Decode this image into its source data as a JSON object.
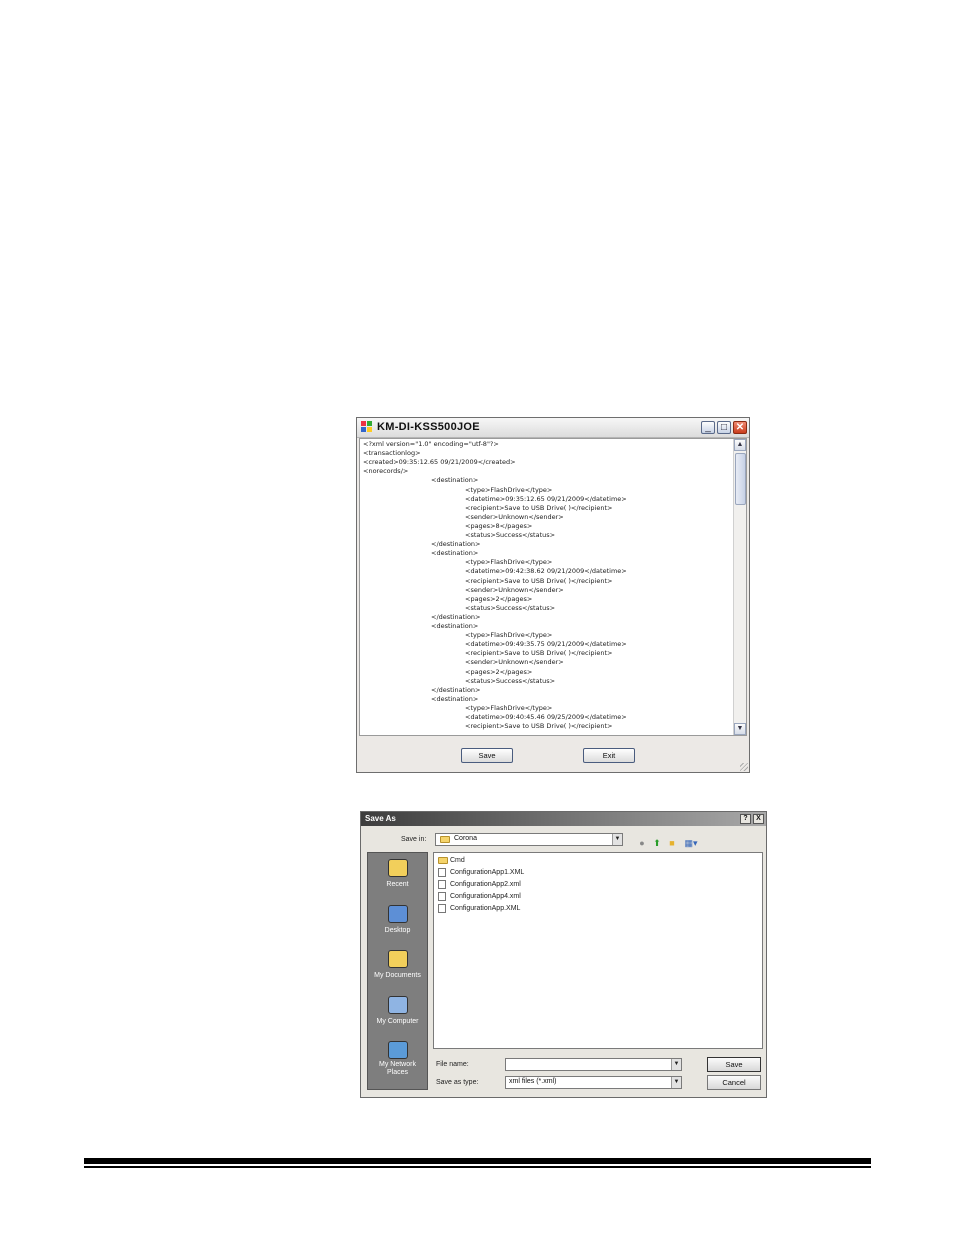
{
  "xml_window": {
    "title": "KM-DI-KSS500JOE",
    "lines": [
      {
        "indent": 0,
        "text": "<?xml version=\"1.0\" encoding=\"utf-8\"?>"
      },
      {
        "indent": 0,
        "text": "<transactionlog>"
      },
      {
        "indent": 0,
        "text": "<created>09:35:12.65 09/21/2009</created>"
      },
      {
        "indent": 0,
        "text": "<norecords/>"
      },
      {
        "indent": 1,
        "text": "<destination>"
      },
      {
        "indent": 2,
        "text": "<type>FlashDrive</type>"
      },
      {
        "indent": 2,
        "text": "<datetime>09:35:12.65 09/21/2009</datetime>"
      },
      {
        "indent": 2,
        "text": "<recipient>Save to USB Drive( )</recipient>"
      },
      {
        "indent": 2,
        "text": "<sender>Unknown</sender>"
      },
      {
        "indent": 2,
        "text": "<pages>8</pages>"
      },
      {
        "indent": 2,
        "text": "<status>Success</status>"
      },
      {
        "indent": 1,
        "text": "</destination>"
      },
      {
        "indent": 1,
        "text": "<destination>"
      },
      {
        "indent": 2,
        "text": "<type>FlashDrive</type>"
      },
      {
        "indent": 2,
        "text": "<datetime>09:42:38.62 09/21/2009</datetime>"
      },
      {
        "indent": 2,
        "text": "<recipient>Save to USB Drive( )</recipient>"
      },
      {
        "indent": 2,
        "text": "<sender>Unknown</sender>"
      },
      {
        "indent": 2,
        "text": "<pages>2</pages>"
      },
      {
        "indent": 2,
        "text": "<status>Success</status>"
      },
      {
        "indent": 1,
        "text": "</destination>"
      },
      {
        "indent": 1,
        "text": "<destination>"
      },
      {
        "indent": 2,
        "text": "<type>FlashDrive</type>"
      },
      {
        "indent": 2,
        "text": "<datetime>09:49:35.75 09/21/2009</datetime>"
      },
      {
        "indent": 2,
        "text": "<recipient>Save to USB Drive( )</recipient>"
      },
      {
        "indent": 2,
        "text": "<sender>Unknown</sender>"
      },
      {
        "indent": 2,
        "text": "<pages>2</pages>"
      },
      {
        "indent": 2,
        "text": "<status>Success</status>"
      },
      {
        "indent": 1,
        "text": "</destination>"
      },
      {
        "indent": 1,
        "text": "<destination>"
      },
      {
        "indent": 2,
        "text": "<type>FlashDrive</type>"
      },
      {
        "indent": 2,
        "text": "<datetime>09:40:45.46 09/25/2009</datetime>"
      },
      {
        "indent": 2,
        "text": "<recipient>Save to USB Drive( )</recipient>"
      }
    ],
    "save_label": "Save",
    "exit_label": "Exit",
    "minimize_glyph": "_",
    "maximize_glyph": "□",
    "close_glyph": "✕",
    "scroll_up_glyph": "▲",
    "scroll_down_glyph": "▼"
  },
  "save_as": {
    "title": "Save As",
    "help_glyph": "?",
    "close_glyph": "X",
    "save_in_label": "Save in:",
    "save_in_value": "Corona",
    "dropdown_glyph": "▼",
    "places": [
      {
        "label": "Recent",
        "icon": "recent-folder-icon",
        "color": "#f2cf5b"
      },
      {
        "label": "Desktop",
        "icon": "desktop-icon",
        "color": "#5d8fd6"
      },
      {
        "label": "My Documents",
        "icon": "my-documents-icon",
        "color": "#f2cf5b"
      },
      {
        "label": "My Computer",
        "icon": "my-computer-icon",
        "color": "#8fb4e3"
      },
      {
        "label": "My Network Places",
        "icon": "network-places-icon",
        "color": "#5b9bd8"
      }
    ],
    "files": [
      {
        "name": "Cmd",
        "kind": "folder"
      },
      {
        "name": "ConfigurationApp1.XML",
        "kind": "file"
      },
      {
        "name": "ConfigurationApp2.xml",
        "kind": "file"
      },
      {
        "name": "ConfigurationApp4.xml",
        "kind": "file"
      },
      {
        "name": "ConfigurationApp.XML",
        "kind": "file"
      }
    ],
    "file_name_label": "File name:",
    "file_name_value": "",
    "save_as_type_label": "Save as type:",
    "save_as_type_value": "xml files (*.xml)",
    "save_label": "Save",
    "cancel_label": "Cancel"
  }
}
